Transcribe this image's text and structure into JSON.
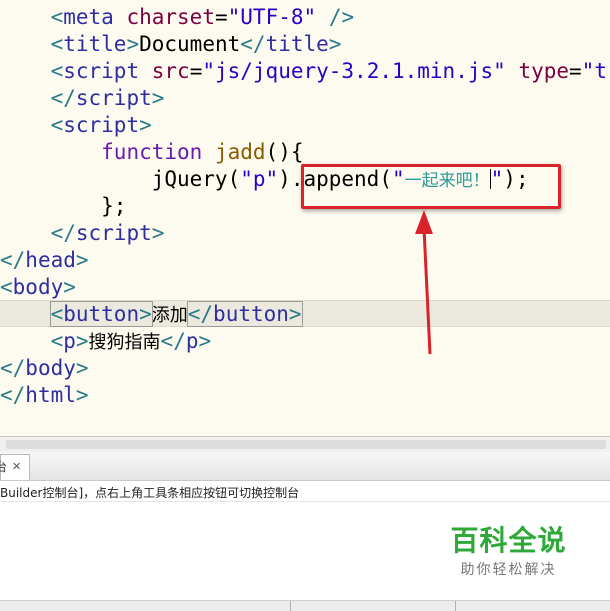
{
  "editor": {
    "l1": {
      "meta": "meta",
      "charset_attr": "charset",
      "charset_val": "\"UTF-8\""
    },
    "l2": {
      "title": "title",
      "text": "Document"
    },
    "l3": {
      "script": "script",
      "src_attr": "src",
      "src_val": "\"js/jquery-3.2.1.min.js\"",
      "type_attr": "type",
      "type_val": "\"t"
    },
    "l4": {
      "script": "script"
    },
    "l5": {
      "script": "script"
    },
    "l6": {
      "keyword": "function",
      "name": "jadd"
    },
    "l7": {
      "obj": "jQuery",
      "arg": "\"p\"",
      "method": "append",
      "str_open": "\"",
      "str_text": "一起来吧！",
      "str_close": "\""
    },
    "l9": {
      "script": "script"
    },
    "l10": {
      "tag": "head"
    },
    "l11": {
      "tag": "body"
    },
    "l12": {
      "tag": "button",
      "text": "添加"
    },
    "l13": {
      "tag": "p",
      "text": "搜狗指南"
    },
    "l14": {
      "tag": "body"
    },
    "l15": {
      "tag": "html"
    }
  },
  "console": {
    "tab_label": "台",
    "message": "Builder控制台]，点右上角工具条相应按钮可切换控制台"
  },
  "watermark": {
    "title": "百科全说",
    "subtitle": "助你轻松解决"
  },
  "colors": {
    "annotation": "#d8232a",
    "background": "#fdfbef",
    "watermark_green": "#2fa83a"
  },
  "icons": [
    "close-icon"
  ]
}
